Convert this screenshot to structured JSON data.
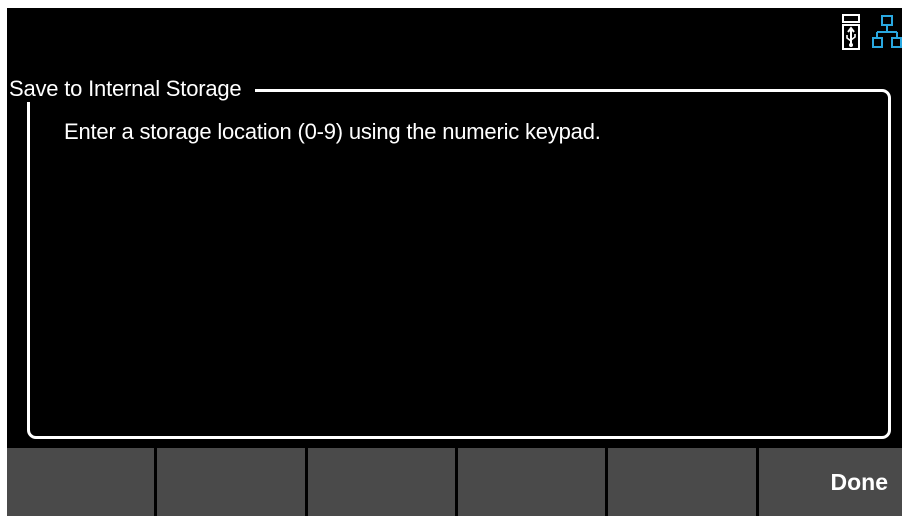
{
  "status_bar": {
    "icons": [
      "usb-storage-icon",
      "network-icon"
    ],
    "colors": {
      "usb": "#ffffff",
      "network": "#2aa8e0"
    }
  },
  "dialog": {
    "title": "Save to Internal Storage",
    "message": "Enter a storage location (0-9) using the numeric keypad."
  },
  "softkeys": {
    "key1": "",
    "key2": "",
    "key3": "",
    "key4": "",
    "key5": "",
    "key6": "Done"
  },
  "colors": {
    "background": "#000000",
    "softkey": "#4a4a4a",
    "text": "#ffffff"
  }
}
